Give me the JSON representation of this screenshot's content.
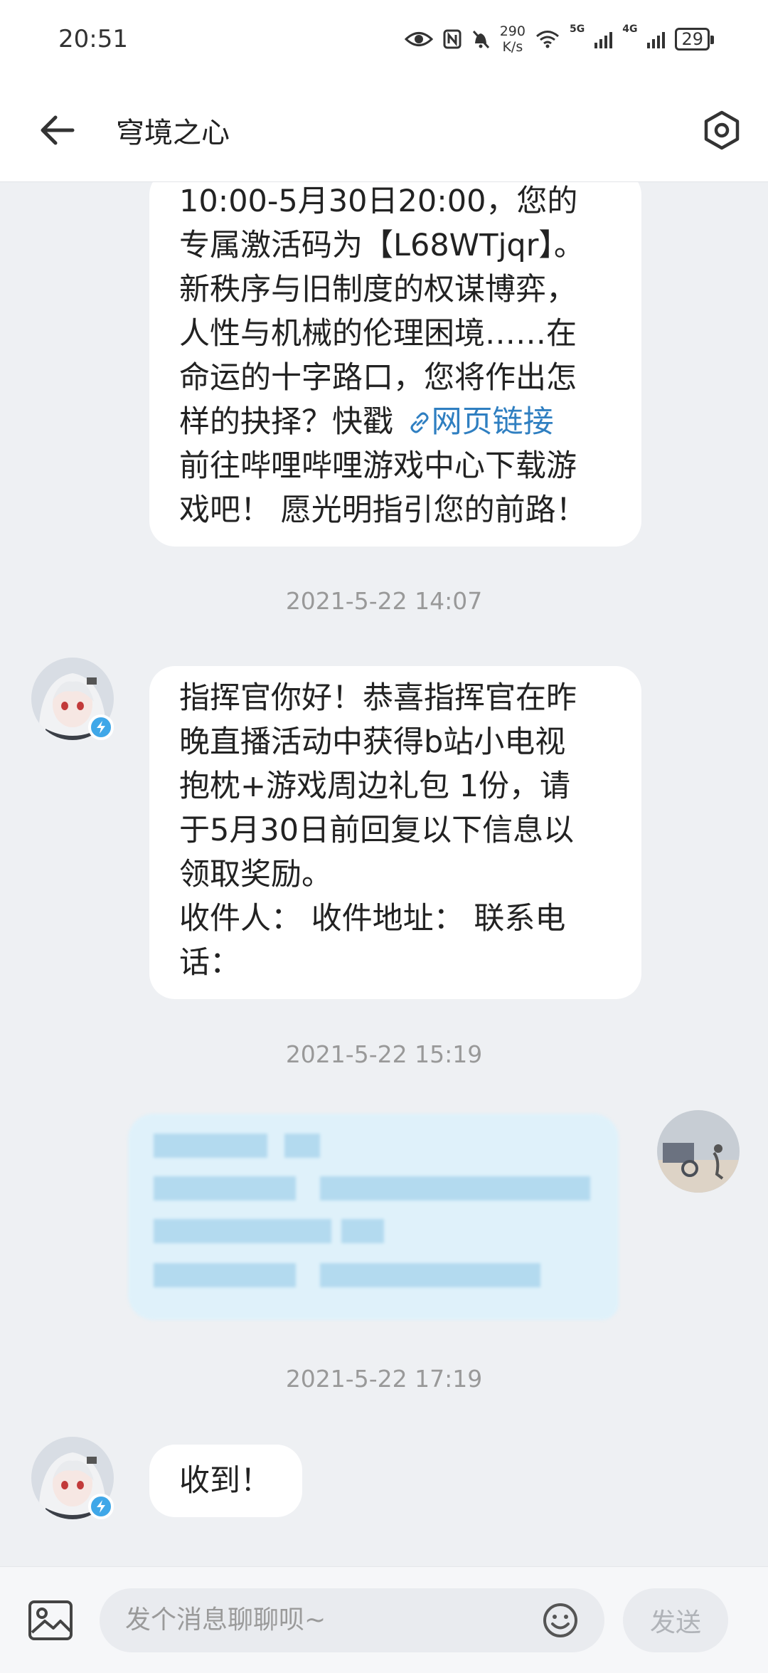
{
  "status_bar": {
    "time": "20:51",
    "net_speed_value": "290",
    "net_speed_unit": "K/s",
    "sim1_label": "5G",
    "sim2_label": "4G",
    "battery": "29"
  },
  "header": {
    "title": "穹境之心",
    "back_icon": "arrow-left-icon",
    "settings_icon": "hexagon-settings-icon"
  },
  "messages": [
    {
      "from": "other",
      "lines": [
        "10:00-5月30日20:00，您的",
        "专属激活码为【L68WTjqr】。",
        "新秩序与旧制度的权谋博弈，",
        "人性与机械的伦理困境……在",
        "命运的十字路口，您将作出怎",
        "样的抉择？快戳",
        "前往哔哩哔哩游戏中心下载游",
        "戏吧！ 愿光明指引您的前路！"
      ],
      "link_text": "网页链接"
    },
    {
      "timestamp": "2021-5-22 14:07",
      "from": "other",
      "lines": [
        "指挥官你好！恭喜指挥官在昨",
        "晚直播活动中获得b站小电视",
        "抱枕+游戏周边礼包 1份，请",
        "于5月30日前回复以下信息以",
        "领取奖励。",
        "收件人： 收件地址： 联系电",
        "话："
      ]
    },
    {
      "timestamp": "2021-5-22 15:19",
      "from": "self",
      "blurred": true
    },
    {
      "timestamp": "2021-5-22 17:19",
      "from": "other",
      "lines": [
        "收到！"
      ]
    }
  ],
  "input_bar": {
    "placeholder": "发个消息聊聊呗~",
    "send_label": "发送"
  },
  "colors": {
    "link": "#2f7fc1",
    "badge": "#3fa7e8",
    "background": "#eef0f3",
    "self_bubble": "#dff1fa"
  }
}
